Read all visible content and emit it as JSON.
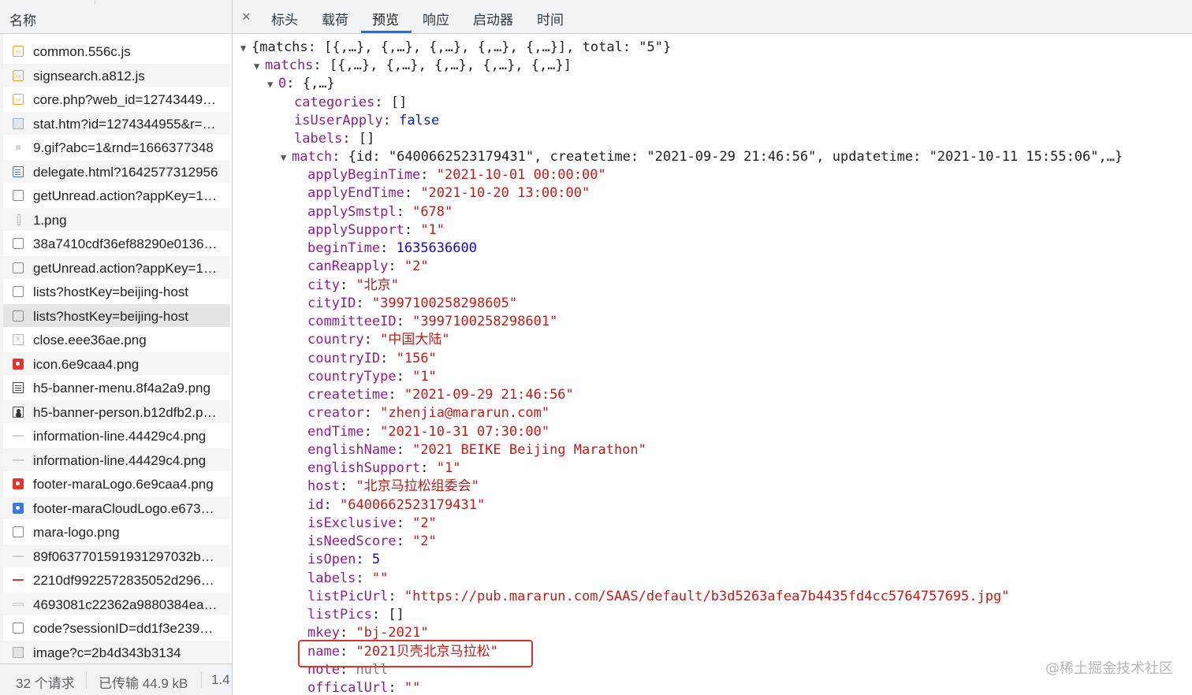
{
  "request_list": {
    "column_header": "名称",
    "items": [
      {
        "name": "common.556c.js",
        "icon": "js-file-icon"
      },
      {
        "name": "signsearch.a812.js",
        "icon": "js-file-icon"
      },
      {
        "name": "core.php?web_id=12743449…",
        "icon": "js-file-icon"
      },
      {
        "name": "stat.htm?id=1274344955&r=…",
        "icon": "image-file-icon"
      },
      {
        "name": "9.gif?abc=1&rnd=1666377348",
        "icon": "gif-file-icon"
      },
      {
        "name": "delegate.html?1642577312956",
        "icon": "document-icon"
      },
      {
        "name": "getUnread.action?appKey=1…",
        "icon": "xhr-icon"
      },
      {
        "name": "1.png",
        "icon": "image-file-icon"
      },
      {
        "name": "38a7410cdf36ef88290e0136…",
        "icon": "xhr-icon"
      },
      {
        "name": "getUnread.action?appKey=1…",
        "icon": "xhr-icon"
      },
      {
        "name": "lists?hostKey=beijing-host",
        "icon": "xhr-icon"
      },
      {
        "name": "lists?hostKey=beijing-host",
        "icon": "xhr-icon"
      },
      {
        "name": "close.eee36ae.png",
        "icon": "close-image-icon"
      },
      {
        "name": "icon.6e9caa4.png",
        "icon": "red-image-icon"
      },
      {
        "name": "h5-banner-menu.8f4a2a9.png",
        "icon": "menu-image-icon"
      },
      {
        "name": "h5-banner-person.b12dfb2.p…",
        "icon": "person-image-icon"
      },
      {
        "name": "information-line.44429c4.png",
        "icon": "line-image-icon"
      },
      {
        "name": "information-line.44429c4.png",
        "icon": "line-image-icon"
      },
      {
        "name": "footer-maraLogo.6e9caa4.png",
        "icon": "red-image-icon"
      },
      {
        "name": "footer-maraCloudLogo.e673…",
        "icon": "blue-image-icon"
      },
      {
        "name": "mara-logo.png",
        "icon": "xhr-icon"
      },
      {
        "name": "89f0637701591931297032b…",
        "icon": "line-image-icon"
      },
      {
        "name": "2210df9922572835052d296…",
        "icon": "red-line-image-icon"
      },
      {
        "name": "4693081c22362a9880384ea…",
        "icon": "dash-image-icon"
      },
      {
        "name": "code?sessionID=dd1f3e239…",
        "icon": "xhr-icon"
      },
      {
        "name": "image?c=2b4d343b3134",
        "icon": "gray-image-icon"
      }
    ],
    "selected_index": 11
  },
  "status_bar": {
    "requests": "32 个请求",
    "transferred": "已传输 44.9 kB",
    "resources": "1.4"
  },
  "tabs": {
    "close": "×",
    "items": [
      "标头",
      "载荷",
      "预览",
      "响应",
      "启动器",
      "时间"
    ],
    "active": "预览"
  },
  "preview": {
    "root_summary": "{matchs: [{,…}, {,…}, {,…}, {,…}, {,…}], total: \"5\"}",
    "matchs_key": "matchs",
    "matchs_summary": "[{,…}, {,…}, {,…}, {,…}, {,…}]",
    "item0_key": "0",
    "item0_summary": "{,…}",
    "categories": {
      "k": "categories",
      "v": "[]"
    },
    "isUserApply": {
      "k": "isUserApply",
      "v": "false"
    },
    "labels_top": {
      "k": "labels",
      "v": "[]"
    },
    "match_key": "match",
    "match_summary": "{id: \"6400662523179431\", createtime: \"2021-09-29 21:46:56\", updatetime: \"2021-10-11 15:55:06\",…}",
    "fields": [
      {
        "k": "applyBeginTime",
        "v": "\"2021-10-01 00:00:00\"",
        "t": "s"
      },
      {
        "k": "applyEndTime",
        "v": "\"2021-10-20 13:00:00\"",
        "t": "s"
      },
      {
        "k": "applySmstpl",
        "v": "\"678\"",
        "t": "s"
      },
      {
        "k": "applySupport",
        "v": "\"1\"",
        "t": "s"
      },
      {
        "k": "beginTime",
        "v": "1635636600",
        "t": "n"
      },
      {
        "k": "canReapply",
        "v": "\"2\"",
        "t": "s"
      },
      {
        "k": "city",
        "v": "\"北京\"",
        "t": "s"
      },
      {
        "k": "cityID",
        "v": "\"3997100258298605\"",
        "t": "s"
      },
      {
        "k": "committeeID",
        "v": "\"3997100258298601\"",
        "t": "s"
      },
      {
        "k": "country",
        "v": "\"中国大陆\"",
        "t": "s"
      },
      {
        "k": "countryID",
        "v": "\"156\"",
        "t": "s"
      },
      {
        "k": "countryType",
        "v": "\"1\"",
        "t": "s"
      },
      {
        "k": "createtime",
        "v": "\"2021-09-29 21:46:56\"",
        "t": "s"
      },
      {
        "k": "creator",
        "v": "\"zhenjia@mararun.com\"",
        "t": "s"
      },
      {
        "k": "endTime",
        "v": "\"2021-10-31 07:30:00\"",
        "t": "s"
      },
      {
        "k": "englishName",
        "v": "\"2021 BEIKE Beijing Marathon\"",
        "t": "s"
      },
      {
        "k": "englishSupport",
        "v": "\"1\"",
        "t": "s"
      },
      {
        "k": "host",
        "v": "\"北京马拉松组委会\"",
        "t": "s"
      },
      {
        "k": "id",
        "v": "\"6400662523179431\"",
        "t": "s"
      },
      {
        "k": "isExclusive",
        "v": "\"2\"",
        "t": "s"
      },
      {
        "k": "isNeedScore",
        "v": "\"2\"",
        "t": "s"
      },
      {
        "k": "isOpen",
        "v": "5",
        "t": "n"
      },
      {
        "k": "labels",
        "v": "\"\"",
        "t": "s"
      },
      {
        "k": "listPicUrl",
        "v": "\"https://pub.mararun.com/SAAS/default/b3d5263afea7b4435fd4cc5764757695.jpg\"",
        "t": "s"
      },
      {
        "k": "listPics",
        "v": "[]",
        "t": "p"
      },
      {
        "k": "mkey",
        "v": "\"bj-2021\"",
        "t": "s"
      },
      {
        "k": "name",
        "v": "\"2021贝壳北京马拉松\"",
        "t": "s"
      },
      {
        "k": "note",
        "v": "null",
        "t": "null"
      },
      {
        "k": "officalUrl",
        "v": "\"\"",
        "t": "s"
      }
    ],
    "highlighted_field": "name"
  },
  "watermark": "@稀土掘金技术社区",
  "colors": {
    "key": "#8e1d8e",
    "string": "#c41a16",
    "number": "#1c00cf",
    "boolean": "#0d22aa",
    "highlight_box": "#e3322b",
    "tab_underline": "#1a73e8"
  }
}
